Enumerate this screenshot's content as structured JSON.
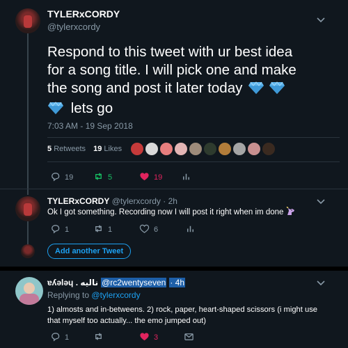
{
  "main_tweet": {
    "display_name": "TYLERxCORDY",
    "handle": "@tylerxcordy",
    "text_lines": [
      "Respond to this tweet with ur best idea",
      "for a song title. I will pick one and make",
      "the song and post it later today",
      "lets go"
    ],
    "timestamp": "7:03 AM - 19 Sep 2018",
    "retweets_count": "5",
    "retweets_label": "Retweets",
    "likes_count": "19",
    "likes_label": "Likes",
    "reply_count": "19",
    "retweet_action_count": "5",
    "like_action_count": "19"
  },
  "reply_1": {
    "display_name": "TYLERxCORDY",
    "handle": "@tylerxcordy",
    "time": "· 2h",
    "text": "Ok I got something. Recording now I will post it right when im done",
    "reply_count": "1",
    "retweet_count": "1",
    "like_count": "6"
  },
  "add_another": {
    "label": "Add another Tweet"
  },
  "reply_2": {
    "display_name": "ɐʎǝlǝɥ . نالیه",
    "handle": "@rc2wentyseven",
    "time": "· 4h",
    "replying_prefix": "Replying to",
    "replying_to": "@tylerxcordy",
    "text_lines": [
      "1) almosts and in-betweens. 2) rock, paper, heart-shaped scissors (i might use",
      "that myself too actually... the emo jumped out)"
    ],
    "reply_count": "1",
    "like_count": "3"
  },
  "colors": {
    "background": "#10171e",
    "accent": "#1da1f2",
    "like": "#e0245e",
    "retweet": "#17bf63",
    "muted": "#8899a6"
  }
}
